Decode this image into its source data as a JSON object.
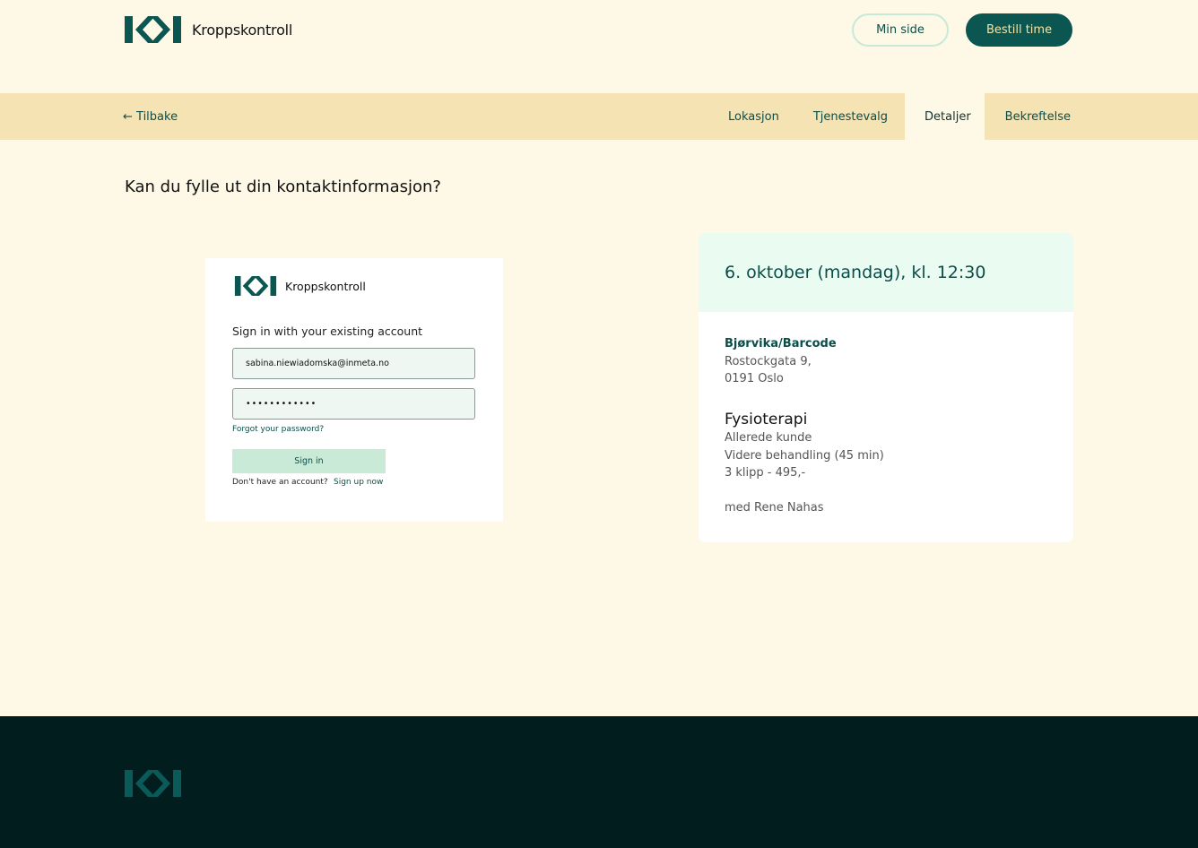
{
  "header": {
    "brand_name": "Kroppskontroll",
    "min_side_label": "Min side",
    "bestill_label": "Bestill time"
  },
  "stepper": {
    "back_label": "← Tilbake",
    "steps": [
      "Lokasjon",
      "Tjenestevalg",
      "Detaljer",
      "Bekreftelse"
    ],
    "active_step": "Detaljer"
  },
  "main": {
    "question": "Kan du fylle ut din kontaktinformasjon?"
  },
  "login": {
    "brand_name": "Kroppskontroll",
    "heading": "Sign in with your existing account",
    "email_value": "sabina.niewiadomska@inmeta.no",
    "password_value": "••••••••••••",
    "forgot_label": "Forgot your password?",
    "signin_label": "Sign in",
    "no_account_text": "Don't have an account?",
    "signup_label": "Sign up now"
  },
  "summary": {
    "datetime": "6. oktober (mandag), kl. 12:30",
    "location_name": "Bjørvika/Barcode",
    "address_line1": "Rostockgata 9,",
    "address_line2": "0191 Oslo",
    "service": "Fysioterapi",
    "customer_type": "Allerede kunde",
    "treatment": "Videre behandling (45 min)",
    "price": "3 klipp - 495,-",
    "therapist": "med Rene Nahas"
  },
  "colors": {
    "background": "#fef8e6",
    "brand_teal": "#0b5651",
    "stepbar": "#f6e3b4",
    "footer": "#011d1d",
    "mint": "#eafbf2"
  }
}
